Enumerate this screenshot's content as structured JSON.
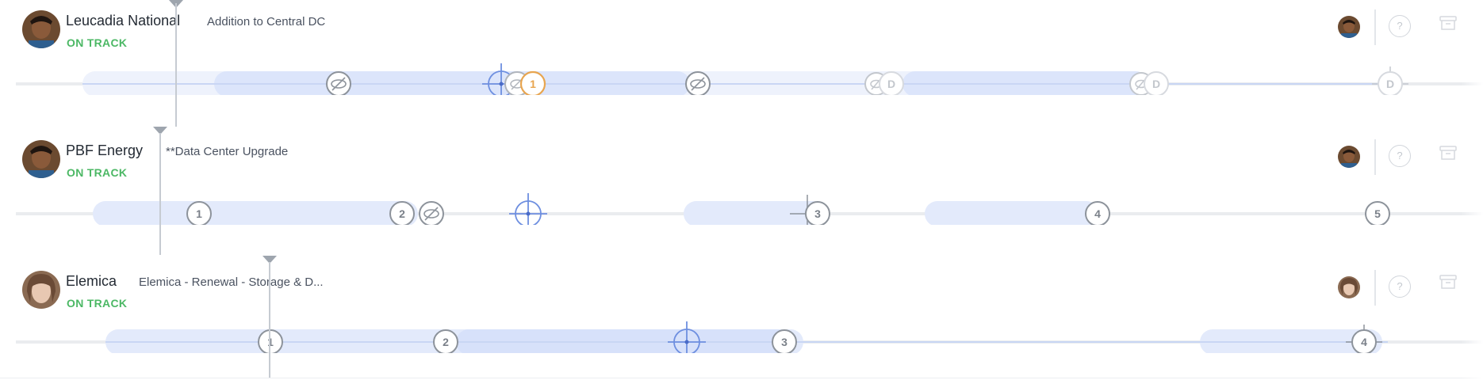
{
  "rows": [
    {
      "company": "Leucadia National",
      "status": "ON TRACK",
      "project": "Addition to Central DC",
      "milestones": [
        "1",
        "D",
        "D",
        "D"
      ]
    },
    {
      "company": "PBF Energy",
      "status": "ON TRACK",
      "project": "**Data Center Upgrade",
      "milestones": [
        "1",
        "2",
        "3",
        "4",
        "5"
      ]
    },
    {
      "company": "Elemica",
      "status": "ON TRACK",
      "project": "Elemica - Renewal - Storage & D...",
      "milestones": [
        "1",
        "2",
        "3",
        "4"
      ]
    }
  ],
  "actions": {
    "help_label": "?"
  },
  "colors": {
    "on_track": "#4cb865",
    "bar": "#dfe7fb",
    "bar_strong": "#d2ddfa",
    "target": "#6e8fe0",
    "warning": "#e8a54f",
    "ghost": "#c3c7cd"
  }
}
